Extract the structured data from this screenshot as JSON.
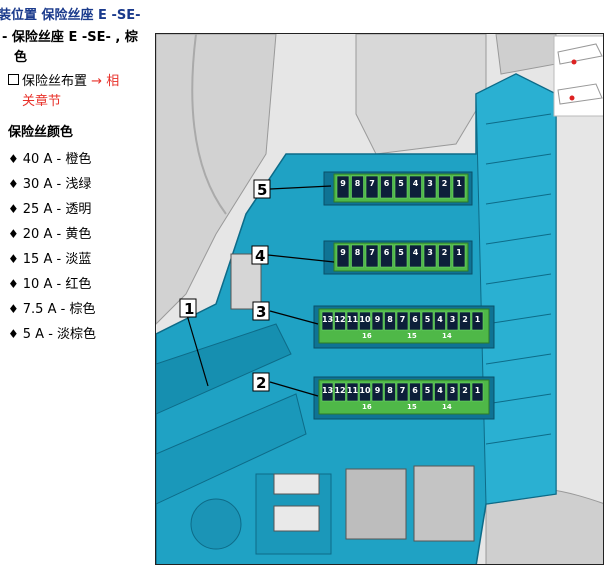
{
  "sidebar": {
    "line1": "装位置 保险丝座 E -SE-",
    "line2": "- 保险丝座 E -SE- , 棕",
    "line3": "色",
    "link_text": "保险丝布置",
    "link_arrow": "→",
    "link_target_1": "相",
    "link_target_2": "关章节",
    "colors_heading": "保险丝颜色",
    "colors": [
      {
        "amp": "40 A",
        "color": "橙色"
      },
      {
        "amp": "30 A",
        "color": "浅绿"
      },
      {
        "amp": "25 A",
        "color": "透明"
      },
      {
        "amp": "20 A",
        "color": "黄色"
      },
      {
        "amp": "15 A",
        "color": "淡蓝"
      },
      {
        "amp": "10 A",
        "color": "红色"
      },
      {
        "amp": "7.5 A",
        "color": "棕色"
      },
      {
        "amp": "5 A",
        "color": "淡棕色"
      }
    ]
  },
  "diagram": {
    "callouts": [
      "1",
      "2",
      "3",
      "4",
      "5"
    ],
    "row5_fuses": [
      "9",
      "8",
      "7",
      "6",
      "5",
      "4",
      "3",
      "2",
      "1"
    ],
    "row4_fuses": [
      "9",
      "8",
      "7",
      "6",
      "5",
      "4",
      "3",
      "2",
      "1"
    ],
    "row3_fuses": [
      "13",
      "12",
      "11",
      "10",
      "9",
      "8",
      "7",
      "6",
      "5",
      "4",
      "3",
      "2",
      "1"
    ],
    "row3_group_labels": [
      "16",
      "15",
      "14"
    ],
    "row2_fuses": [
      "13",
      "12",
      "11",
      "10",
      "9",
      "8",
      "7",
      "6",
      "5",
      "4",
      "3",
      "2",
      "1"
    ],
    "row2_group_labels": [
      "16",
      "15",
      "14"
    ],
    "colors": {
      "housing": "#1e9ec0",
      "housing_dark": "#0f6f8c",
      "fuse_block": "#4fb848",
      "fuse_dark": "#0d1f3a",
      "bg_gray": "#e4e4e4"
    }
  }
}
